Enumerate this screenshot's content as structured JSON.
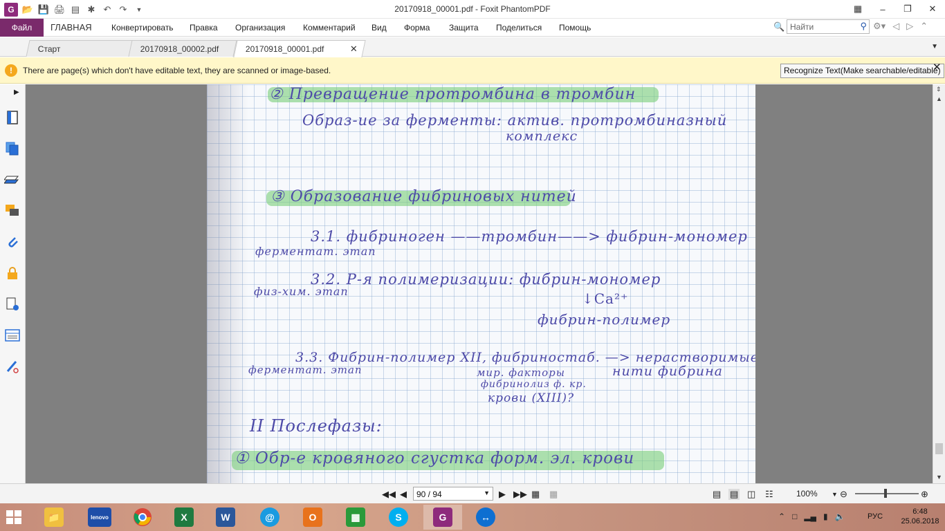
{
  "window": {
    "title": "20170918_00001.pdf - Foxit PhantomPDF"
  },
  "ribbon": {
    "file_label": "Файл",
    "items": [
      "ГЛАВНАЯ",
      "Конвертировать",
      "Правка",
      "Организация",
      "Комментарий",
      "Вид",
      "Форма",
      "Защита",
      "Поделиться",
      "Помощь"
    ],
    "search_placeholder": "Найти"
  },
  "tabs": [
    {
      "label": "Старт",
      "active": false
    },
    {
      "label": "20170918_00002.pdf",
      "active": false
    },
    {
      "label": "20170918_00001.pdf",
      "active": true
    }
  ],
  "notification": {
    "message": "There are page(s) which don't have editable text, they are scanned or image-based.",
    "button_label": "Recognize Text(Make searchable/editable)"
  },
  "leftnav": {
    "icons": [
      "bookmark-icon",
      "pages-icon",
      "layers-icon",
      "comments-icon",
      "attachments-icon",
      "security-icon",
      "document-properties-icon",
      "form-fields-icon",
      "signature-icon"
    ]
  },
  "page_content": {
    "lines": [
      {
        "id": "l1",
        "text": "② Превращение протромбина в тромбин"
      },
      {
        "id": "l2",
        "text": "Образ-ие за ферменты: актив. протромбиназный"
      },
      {
        "id": "l3",
        "text": "комплекс"
      },
      {
        "id": "l4",
        "text": "③ Образование фибриновых нитей"
      },
      {
        "id": "l5",
        "text": "3.1. фибриноген ——тромбин——> фибрин-мономер"
      },
      {
        "id": "l6",
        "text": "ферментат. этап"
      },
      {
        "id": "l7",
        "text": "3.2. Р-я полимеризации: фибрин-мономер"
      },
      {
        "id": "l8",
        "text": "физ-хим. этап"
      },
      {
        "id": "l9",
        "text": "↓Ca²⁺"
      },
      {
        "id": "l10",
        "text": "фибрин-полимер"
      },
      {
        "id": "l11",
        "text": "3.3. Фибрин-полимер XII, фибриностаб. —> нерастворимые"
      },
      {
        "id": "l12",
        "text": "ферментат. этап"
      },
      {
        "id": "l13",
        "text": "мир. факторы"
      },
      {
        "id": "l14",
        "text": "нити фибрина"
      },
      {
        "id": "l15",
        "text": "фибринолиз ф. кр."
      },
      {
        "id": "l16",
        "text": "крови (XIII)?"
      },
      {
        "id": "l17",
        "text": "II Послефазы:"
      },
      {
        "id": "l18",
        "text": "① Обр-е кровяного сгустка форм. эл. крови"
      }
    ]
  },
  "status": {
    "page_indicator": "90 / 94",
    "zoom": "100%",
    "zoom_fraction": 0.45
  },
  "taskbar": {
    "apps": [
      "file-explorer",
      "lenovo",
      "chrome",
      "excel",
      "word",
      "mail",
      "outlook",
      "store",
      "skype",
      "foxit-phantompdf",
      "teamviewer"
    ],
    "language": "РУС",
    "time": "6:48",
    "date": "25.06.2018"
  },
  "colors": {
    "accent": "#7a2a6b",
    "notice_bg": "#fff7c9",
    "ink": "#4d4aa8",
    "highlighter": "#78cd78"
  }
}
